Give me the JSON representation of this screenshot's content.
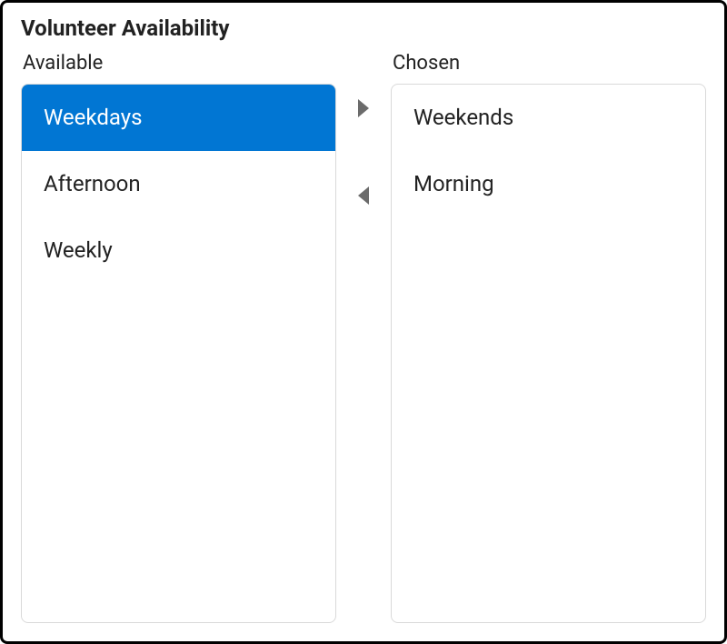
{
  "title": "Volunteer Availability",
  "available": {
    "label": "Available",
    "items": [
      {
        "label": "Weekdays",
        "selected": true
      },
      {
        "label": "Afternoon",
        "selected": false
      },
      {
        "label": "Weekly",
        "selected": false
      }
    ]
  },
  "chosen": {
    "label": "Chosen",
    "items": [
      {
        "label": "Weekends",
        "selected": false
      },
      {
        "label": "Morning",
        "selected": false
      }
    ]
  }
}
